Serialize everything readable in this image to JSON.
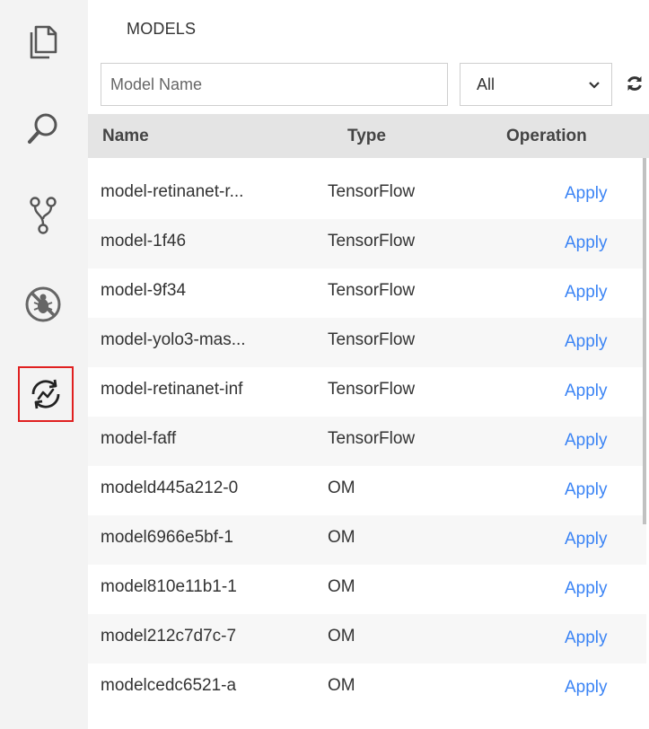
{
  "activity_bar": {
    "items": [
      {
        "icon": "files-icon",
        "active": false
      },
      {
        "icon": "search-icon",
        "active": false
      },
      {
        "icon": "source-control-icon",
        "active": false
      },
      {
        "icon": "debug-icon",
        "active": false
      },
      {
        "icon": "models-icon",
        "active": true
      }
    ],
    "highlight_color": "#e02020"
  },
  "panel": {
    "title": "MODELS",
    "search": {
      "placeholder": "Model Name",
      "value": ""
    },
    "type_filter": {
      "selected": "All"
    },
    "table": {
      "columns": {
        "name": "Name",
        "type": "Type",
        "operation": "Operation"
      },
      "rows": [
        {
          "name": "model-retinanet-r...",
          "type": "TensorFlow",
          "operation": "Apply"
        },
        {
          "name": "model-1f46",
          "type": "TensorFlow",
          "operation": "Apply"
        },
        {
          "name": "model-9f34",
          "type": "TensorFlow",
          "operation": "Apply"
        },
        {
          "name": "model-yolo3-mas...",
          "type": "TensorFlow",
          "operation": "Apply"
        },
        {
          "name": "model-retinanet-inf",
          "type": "TensorFlow",
          "operation": "Apply"
        },
        {
          "name": "model-faff",
          "type": "TensorFlow",
          "operation": "Apply"
        },
        {
          "name": "modeld445a212-0",
          "type": "OM",
          "operation": "Apply"
        },
        {
          "name": "model6966e5bf-1",
          "type": "OM",
          "operation": "Apply"
        },
        {
          "name": "model810e11b1-1",
          "type": "OM",
          "operation": "Apply"
        },
        {
          "name": "model212c7d7c-7",
          "type": "OM",
          "operation": "Apply"
        },
        {
          "name": "modelcedc6521-a",
          "type": "OM",
          "operation": "Apply"
        }
      ]
    },
    "link_color": "#3b84f5"
  }
}
